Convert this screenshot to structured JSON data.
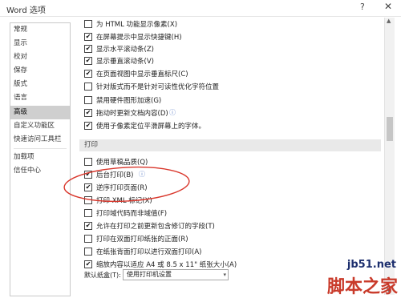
{
  "window": {
    "title": "Word 选项",
    "help": "?",
    "close": "✕"
  },
  "sidebar": {
    "items": [
      {
        "label": "常规",
        "selected": false
      },
      {
        "label": "显示",
        "selected": false
      },
      {
        "label": "校对",
        "selected": false
      },
      {
        "label": "保存",
        "selected": false
      },
      {
        "label": "版式",
        "selected": false
      },
      {
        "label": "语言",
        "selected": false
      },
      {
        "label": "高级",
        "selected": true
      },
      {
        "label": "自定义功能区",
        "selected": false
      },
      {
        "label": "快速访问工具栏",
        "selected": false
      },
      {
        "label": "加载项",
        "selected": false
      },
      {
        "label": "信任中心",
        "selected": false
      }
    ]
  },
  "display_options": [
    {
      "label": "为 HTML 功能显示像素(X)",
      "checked": false
    },
    {
      "label": "在屏幕提示中显示快捷键(H)",
      "checked": true
    },
    {
      "label": "显示水平滚动条(Z)",
      "checked": true
    },
    {
      "label": "显示垂直滚动条(V)",
      "checked": true
    },
    {
      "label": "在页面视图中显示垂直标尺(C)",
      "checked": true
    },
    {
      "label": "针对版式而不是针对可读性优化字符位置",
      "checked": false
    },
    {
      "label": "禁用硬件图形加速(G)",
      "checked": false
    },
    {
      "label": "拖动时更新文档内容(D)",
      "checked": true,
      "info": "ⓘ"
    },
    {
      "label": "使用子像素定位平滑屏幕上的字体。",
      "checked": true
    }
  ],
  "print_section": {
    "title": "打印",
    "options": [
      {
        "label": "使用草稿品质(Q)",
        "checked": false
      },
      {
        "label": "后台打印(B)",
        "checked": true,
        "info": "ⓘ"
      },
      {
        "label": "逆序打印页面(R)",
        "checked": true
      },
      {
        "label": "打印 XML 标记(X)",
        "checked": false
      },
      {
        "label": "打印域代码而非域值(F)",
        "checked": false
      },
      {
        "label": "允许在打印之前更新包含修订的字段(T)",
        "checked": true
      },
      {
        "label": "打印在双面打印纸张的正面(R)",
        "checked": false
      },
      {
        "label": "在纸张背面打印以进行双面打印(A)",
        "checked": false
      },
      {
        "label": "缩放内容以适应 A4 或 8.5 x 11\" 纸张大小(A)",
        "checked": true
      }
    ],
    "paper_tray_label": "默认纸盒(T):",
    "paper_tray_value": "使用打印机设置"
  },
  "icons": {
    "check": "✔",
    "scroll_up": "▲",
    "scroll_down": "▼",
    "caret": "▾"
  },
  "colors": {
    "annotation": "#d9362b",
    "selected_bg": "#cfcfcf",
    "section_bg": "#e9e9e9"
  },
  "watermark": {
    "url": "jb51.net",
    "text": "脚本之家"
  }
}
